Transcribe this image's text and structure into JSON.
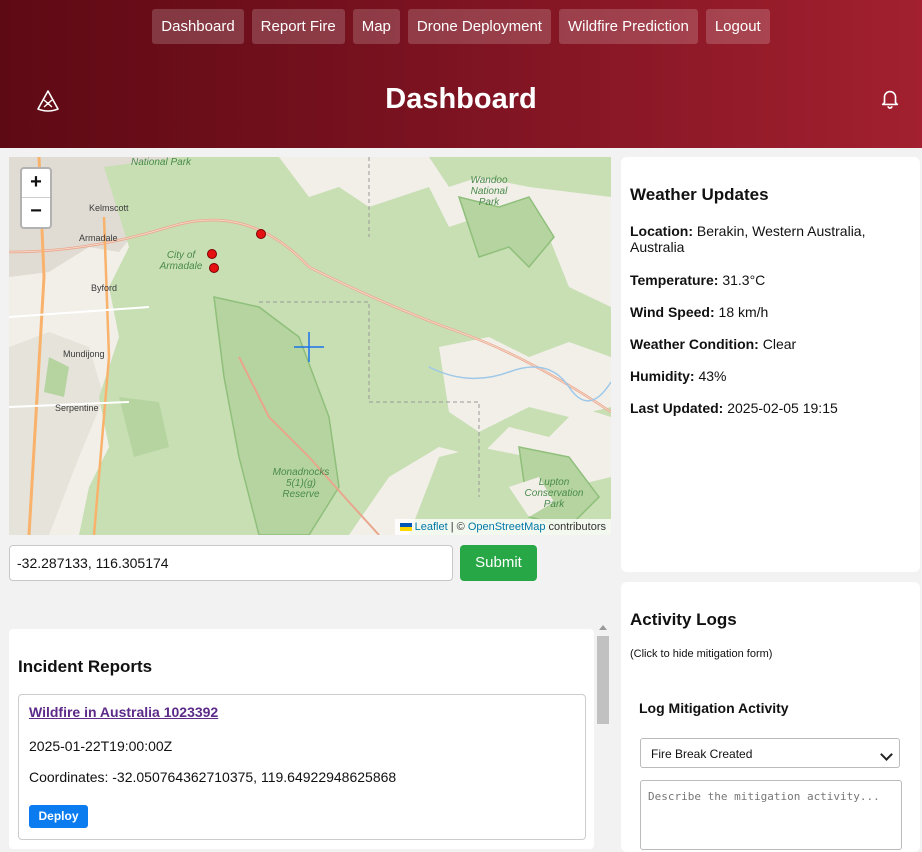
{
  "nav": {
    "items": [
      "Dashboard",
      "Report Fire",
      "Map",
      "Drone Deployment",
      "Wildfire Prediction",
      "Logout"
    ]
  },
  "header": {
    "title": "Dashboard",
    "logo_icon": "drone-icon",
    "notification_icon": "bell-icon"
  },
  "map": {
    "zoom_in": "+",
    "zoom_out": "−",
    "labels": [
      "National Park",
      "Kelmscott",
      "Armadale",
      "City of Armadale",
      "Byford",
      "Mundijong",
      "Serpentine",
      "Wandoo National Park",
      "Monadnocks 5(1)(g) Reserve",
      "Lupton Conservation Park"
    ],
    "attribution": {
      "leaflet": "Leaflet",
      "separator": " | © ",
      "osm": "OpenStreetMap",
      "suffix": " contributors"
    },
    "markers": 3
  },
  "coordinate_form": {
    "value": "-32.287133, 116.305174",
    "submit_label": "Submit"
  },
  "incidents": {
    "title": "Incident Reports",
    "items": [
      {
        "name": "Wildfire in Australia 1023392",
        "date": "2025-01-22T19:00:00Z",
        "coordinates": "Coordinates: -32.050764362710375, 119.64922948625868",
        "action": "Deploy"
      }
    ]
  },
  "weather": {
    "title": "Weather Updates",
    "location_label": "Location:",
    "location": " Berakin, Western Australia, Australia",
    "temperature_label": "Temperature:",
    "temperature": " 31.3°C",
    "wind_label": "Wind Speed:",
    "wind": " 18 km/h",
    "condition_label": "Weather Condition:",
    "condition": " Clear",
    "humidity_label": "Humidity:",
    "humidity": " 43%",
    "updated_label": "Last Updated:",
    "updated": " 2025-02-05 19:15"
  },
  "activity": {
    "title": "Activity Logs",
    "hint": "(Click to hide mitigation form)",
    "form_title": "Log Mitigation Activity",
    "selected_type": "Fire Break Created",
    "description_placeholder": "Describe the mitigation activity..."
  },
  "colors": {
    "header_start": "#5e0a14",
    "header_end": "#a2202f",
    "submit": "#27a745",
    "deploy": "#0a7cf0",
    "marker": "#e51010"
  }
}
